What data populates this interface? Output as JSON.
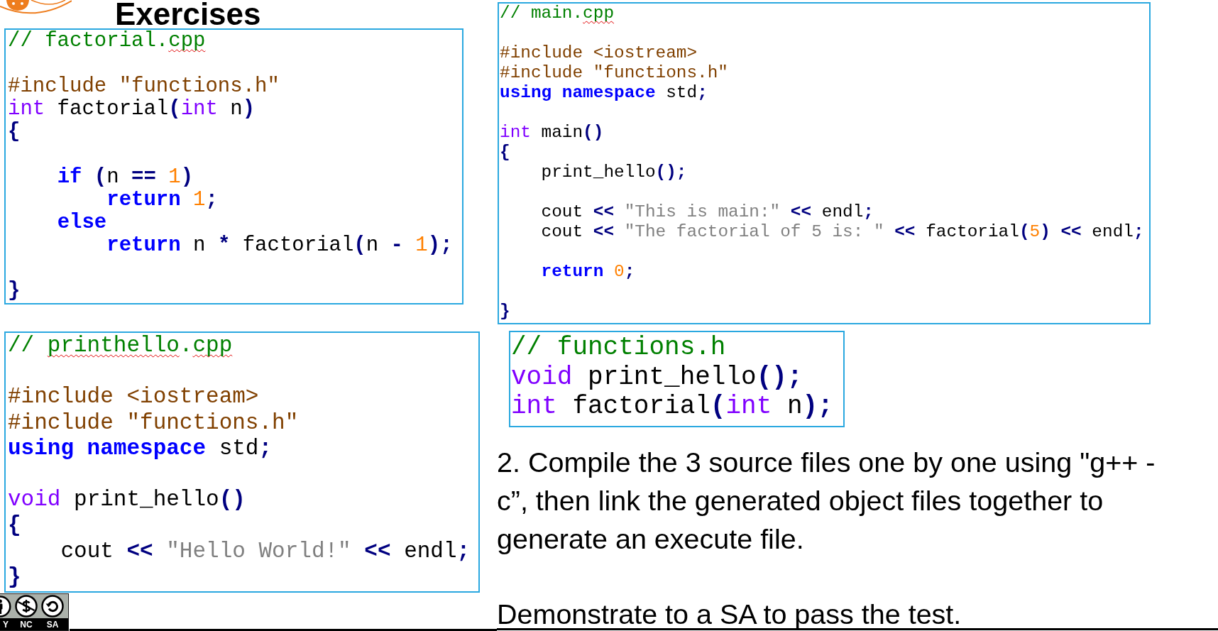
{
  "title": "Exercises",
  "code_files": [
    {
      "blocks": [
        [
          [
            {
              "kind": "comment",
              "text": "// factorial."
            },
            {
              "kind": "misspelled",
              "text": "cpp"
            }
          ]
        ],
        [
          [
            {
              "kind": "preproc",
              "text": "#include \"functions.h\""
            }
          ],
          [
            {
              "kind": "type",
              "text": "int"
            },
            {
              "kind": "plain",
              "text": " factorial"
            },
            {
              "kind": "op",
              "text": "("
            },
            {
              "kind": "type",
              "text": "int"
            },
            {
              "kind": "plain",
              "text": " n"
            },
            {
              "kind": "op",
              "text": ")"
            }
          ],
          [
            {
              "kind": "op",
              "text": "{"
            }
          ]
        ],
        [
          [
            {
              "kind": "keyword",
              "text": "    if "
            },
            {
              "kind": "op",
              "text": "("
            },
            {
              "kind": "plain",
              "text": "n "
            },
            {
              "kind": "op",
              "text": "=="
            },
            {
              "kind": "number",
              "text": " 1"
            },
            {
              "kind": "op",
              "text": ")"
            }
          ],
          [
            {
              "kind": "keyword",
              "text": "        return "
            },
            {
              "kind": "number",
              "text": "1"
            },
            {
              "kind": "op",
              "text": ";"
            }
          ],
          [
            {
              "kind": "keyword",
              "text": "    else"
            }
          ],
          [
            {
              "kind": "keyword",
              "text": "        return "
            },
            {
              "kind": "plain",
              "text": "n "
            },
            {
              "kind": "op",
              "text": "*"
            },
            {
              "kind": "plain",
              "text": " factorial"
            },
            {
              "kind": "op",
              "text": "("
            },
            {
              "kind": "plain",
              "text": "n "
            },
            {
              "kind": "op",
              "text": "-"
            },
            {
              "kind": "number",
              "text": " 1"
            },
            {
              "kind": "op",
              "text": ");"
            }
          ]
        ],
        [
          [
            {
              "kind": "op",
              "text": "}"
            }
          ]
        ]
      ]
    },
    {
      "blocks": [
        [
          [
            {
              "kind": "comment",
              "text": "// main."
            },
            {
              "kind": "misspelled",
              "text": "cpp"
            }
          ]
        ],
        [
          [
            {
              "kind": "preproc",
              "text": "#include <iostream>"
            }
          ],
          [
            {
              "kind": "preproc",
              "text": "#include \"functions.h\""
            }
          ],
          [
            {
              "kind": "keyword",
              "text": "using namespace "
            },
            {
              "kind": "plain",
              "text": "std"
            },
            {
              "kind": "op",
              "text": ";"
            }
          ]
        ],
        [
          [
            {
              "kind": "type",
              "text": "int"
            },
            {
              "kind": "plain",
              "text": " main"
            },
            {
              "kind": "op",
              "text": "()"
            }
          ],
          [
            {
              "kind": "op",
              "text": "{"
            }
          ],
          [
            {
              "kind": "plain",
              "text": "    print_hello"
            },
            {
              "kind": "op",
              "text": "();"
            }
          ]
        ],
        [
          [
            {
              "kind": "plain",
              "text": "    cout "
            },
            {
              "kind": "op",
              "text": "<<"
            },
            {
              "kind": "string",
              "text": " \"This is main:\" "
            },
            {
              "kind": "op",
              "text": "<<"
            },
            {
              "kind": "plain",
              "text": " endl"
            },
            {
              "kind": "op",
              "text": ";"
            }
          ],
          [
            {
              "kind": "plain",
              "text": "    cout "
            },
            {
              "kind": "op",
              "text": "<<"
            },
            {
              "kind": "string",
              "text": " \"The factorial of 5 is: \" "
            },
            {
              "kind": "op",
              "text": "<<"
            },
            {
              "kind": "plain",
              "text": " factorial"
            },
            {
              "kind": "op",
              "text": "("
            },
            {
              "kind": "number",
              "text": "5"
            },
            {
              "kind": "op",
              "text": ") <<"
            },
            {
              "kind": "plain",
              "text": " endl"
            },
            {
              "kind": "op",
              "text": ";"
            }
          ]
        ],
        [
          [
            {
              "kind": "keyword",
              "text": "    return "
            },
            {
              "kind": "number",
              "text": "0"
            },
            {
              "kind": "op",
              "text": ";"
            }
          ]
        ],
        [
          [
            {
              "kind": "op",
              "text": "}"
            }
          ]
        ]
      ]
    },
    {
      "blocks": [
        [
          [
            {
              "kind": "comment",
              "text": "// "
            },
            {
              "kind": "misspelled",
              "text": "printhello"
            },
            {
              "kind": "comment",
              "text": "."
            },
            {
              "kind": "misspelled",
              "text": "cpp"
            }
          ]
        ],
        [
          [
            {
              "kind": "preproc",
              "text": "#include <iostream>"
            }
          ],
          [
            {
              "kind": "preproc",
              "text": "#include \"functions.h\""
            }
          ],
          [
            {
              "kind": "keyword",
              "text": "using namespace "
            },
            {
              "kind": "plain",
              "text": "std"
            },
            {
              "kind": "op",
              "text": ";"
            }
          ]
        ],
        [
          [
            {
              "kind": "type",
              "text": "void"
            },
            {
              "kind": "plain",
              "text": " print_hello"
            },
            {
              "kind": "op",
              "text": "()"
            }
          ],
          [
            {
              "kind": "op",
              "text": "{"
            }
          ],
          [
            {
              "kind": "plain",
              "text": "    cout "
            },
            {
              "kind": "op",
              "text": "<<"
            },
            {
              "kind": "string",
              "text": " \"Hello World!\" "
            },
            {
              "kind": "op",
              "text": "<<"
            },
            {
              "kind": "plain",
              "text": " endl"
            },
            {
              "kind": "op",
              "text": ";"
            }
          ],
          [
            {
              "kind": "op",
              "text": "}"
            }
          ]
        ]
      ]
    },
    {
      "blocks": [
        [
          [
            {
              "kind": "comment",
              "text": "// functions.h"
            }
          ],
          [
            {
              "kind": "type",
              "text": "void"
            },
            {
              "kind": "plain",
              "text": " print_hello"
            },
            {
              "kind": "op",
              "text": "();"
            }
          ],
          [
            {
              "kind": "type",
              "text": "int"
            },
            {
              "kind": "plain",
              "text": " factorial"
            },
            {
              "kind": "op",
              "text": "("
            },
            {
              "kind": "type",
              "text": "int"
            },
            {
              "kind": "plain",
              "text": " n"
            },
            {
              "kind": "op",
              "text": ");"
            }
          ]
        ]
      ]
    }
  ],
  "instructions": {
    "lines": [
      "2. Compile the 3 source files one by one using \"g++ -",
      "c”, then link the generated object files together to",
      "generate an execute file."
    ]
  },
  "note": "Demonstrate to a SA to pass the test.",
  "license_badge": {
    "labels": [
      "Y",
      "NC",
      "SA"
    ]
  }
}
